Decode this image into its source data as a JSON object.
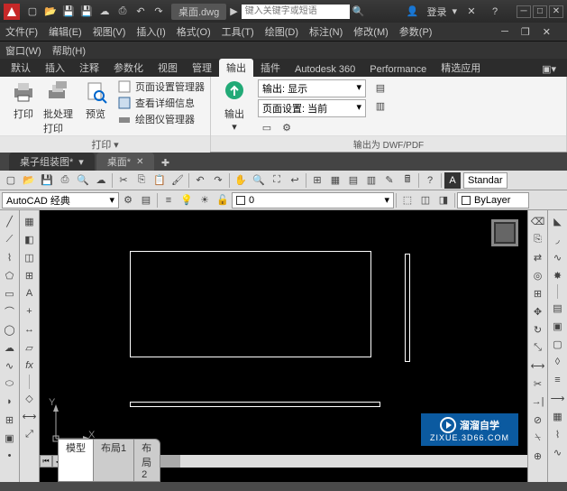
{
  "titlebar": {
    "filename": "桌面.dwg",
    "search_placeholder": "键入关键字或短语",
    "login": "登录"
  },
  "menus1": [
    "文件(F)",
    "编辑(E)",
    "视图(V)",
    "插入(I)",
    "格式(O)",
    "工具(T)",
    "绘图(D)",
    "标注(N)",
    "修改(M)",
    "参数(P)"
  ],
  "menus2": [
    "窗口(W)",
    "帮助(H)"
  ],
  "ribbon_tabs": [
    "默认",
    "插入",
    "注释",
    "参数化",
    "视图",
    "管理",
    "输出",
    "插件",
    "Autodesk 360",
    "Performance",
    "精选应用"
  ],
  "ribbon_active": "输出",
  "ribbon": {
    "print_panel": {
      "title": "打印",
      "print": "打印",
      "batch_print": "批处理打印",
      "preview": "预览",
      "page_setup_mgr": "页面设置管理器",
      "view_details": "查看详细信息",
      "plotter_mgr": "绘图仪管理器"
    },
    "export_panel": {
      "title": "输出为 DWF/PDF",
      "export": "输出",
      "output_display": "输出: 显示",
      "page_setup_current": "页面设置: 当前"
    }
  },
  "doc_tabs": [
    {
      "label": "桌子组装图*"
    },
    {
      "label": "桌面*"
    }
  ],
  "workspace_combo": "AutoCAD 经典",
  "layer_combo": "0",
  "bylayer": "ByLayer",
  "standard": "Standar",
  "canvas_tabs": {
    "model": "模型",
    "layout1": "布局1",
    "layout2": "布局2"
  },
  "ucs": {
    "x": "X",
    "y": "Y"
  },
  "watermark": {
    "brand": "溜溜自学",
    "url": "ZIXUE.3D66.COM"
  }
}
